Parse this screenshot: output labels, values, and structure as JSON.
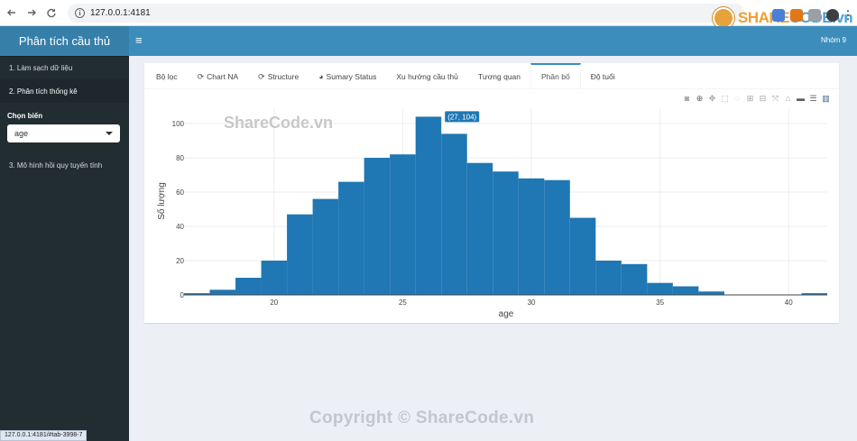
{
  "browser": {
    "url": "127.0.0.1:4181",
    "status_url": "127.0.0.1:4181/#tab-3998-7"
  },
  "watermark": {
    "logo_share": "SHARE",
    "logo_code": "CODE.vn",
    "plot_text": "ShareCode.vn",
    "copyright": "Copyright © ShareCode.vn"
  },
  "header": {
    "brand": "Phân tích cầu thủ",
    "menu_icon": "hamburger-icon",
    "user": "Nhóm 9"
  },
  "sidebar": {
    "items": [
      {
        "label": "1. Làm sạch dữ liệu"
      },
      {
        "label": "2. Phân tích thống kê"
      },
      {
        "label": "3. Mô hình hồi quy tuyến tính"
      }
    ],
    "select_label": "Chọn biến",
    "select_value": "age"
  },
  "tabs": [
    {
      "label": "Bộ lọc",
      "icon": ""
    },
    {
      "label": "Chart NA",
      "icon": "spinner-icon"
    },
    {
      "label": "Structure",
      "icon": "spinner-icon"
    },
    {
      "label": "Sumary Status",
      "icon": "pie-chart-icon"
    },
    {
      "label": "Xu hướng cầu thủ",
      "icon": ""
    },
    {
      "label": "Tương quan",
      "icon": ""
    },
    {
      "label": "Phân bố",
      "icon": ""
    },
    {
      "label": "Độ tuổi",
      "icon": ""
    }
  ],
  "active_tab": "Phân bố",
  "colors": {
    "bar": "#1f77b4",
    "header": "#3c8dbc",
    "sidebar": "#222d32"
  },
  "chart_data": {
    "type": "bar",
    "subtype": "histogram",
    "xlabel": "age",
    "ylabel": "Số lượng",
    "bin_width": 1,
    "x": [
      17,
      18,
      19,
      20,
      21,
      22,
      23,
      24,
      25,
      26,
      27,
      28,
      29,
      30,
      31,
      32,
      33,
      34,
      35,
      36,
      37,
      38,
      39,
      40,
      41
    ],
    "values": [
      1,
      3,
      10,
      20,
      47,
      56,
      66,
      80,
      82,
      104,
      94,
      77,
      72,
      68,
      67,
      45,
      20,
      18,
      7,
      5,
      2,
      0,
      0,
      0,
      1
    ],
    "xlim": [
      16.5,
      41.5
    ],
    "ylim": [
      0,
      104
    ],
    "xticks": [
      20,
      25,
      30,
      35,
      40
    ],
    "yticks": [
      0,
      20,
      40,
      60,
      80,
      100
    ],
    "grid": true,
    "tooltip": "(27, 104)"
  }
}
